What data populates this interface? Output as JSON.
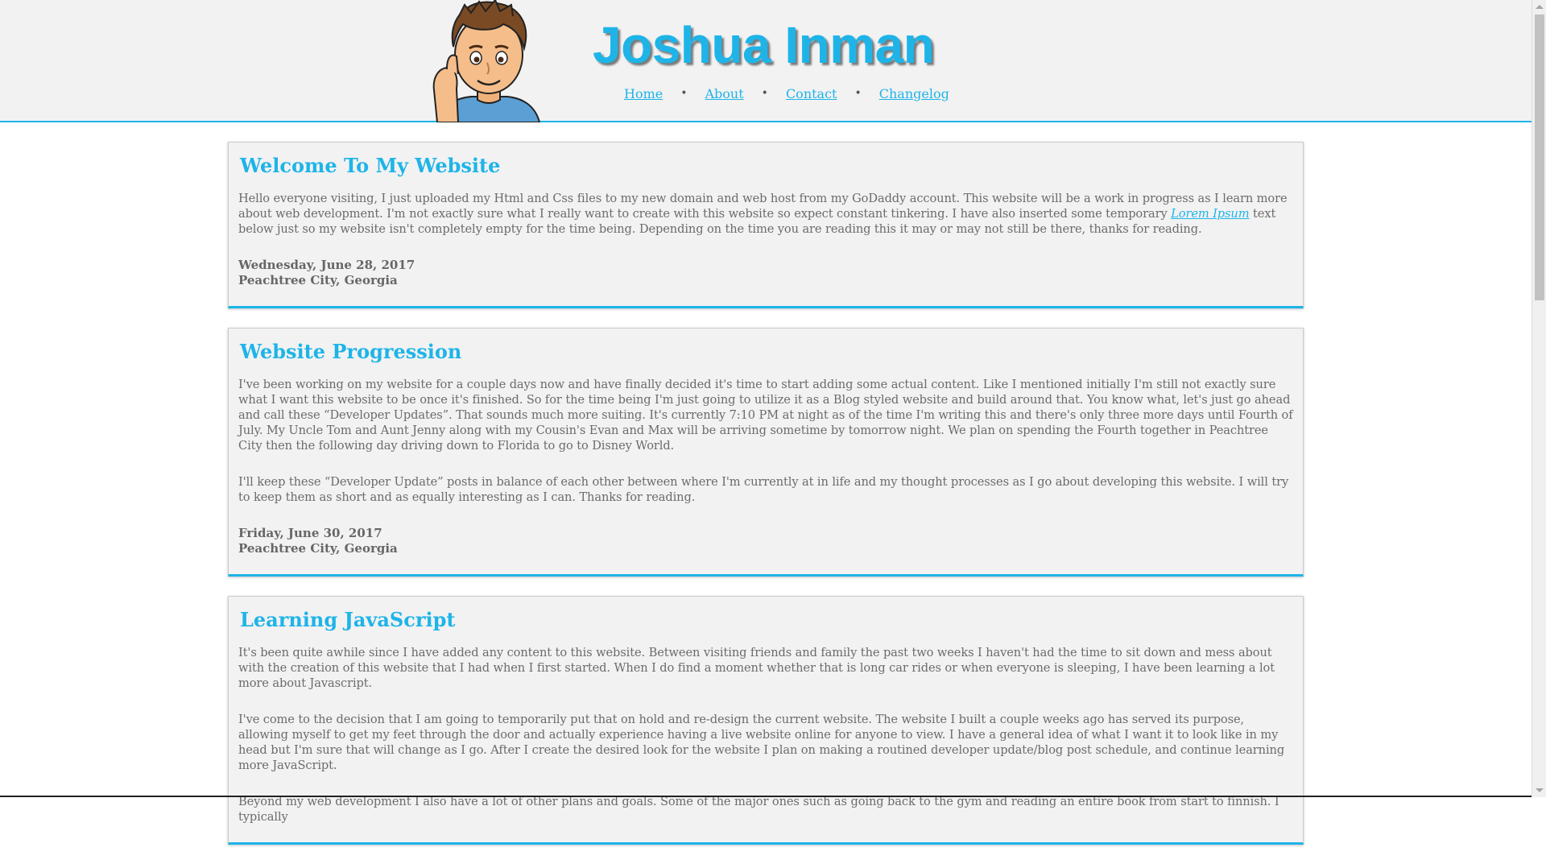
{
  "header": {
    "site_title": "Joshua Inman",
    "nav": [
      {
        "label": "Home"
      },
      {
        "label": "About"
      },
      {
        "label": "Contact"
      },
      {
        "label": "Changelog"
      }
    ],
    "separator": "•"
  },
  "posts": [
    {
      "title": "Welcome To My Website",
      "p1_before": "Hello everyone visiting, I just uploaded my Html and Css files to my new domain and web host from my GoDaddy account. This website will be a work in progress as I learn more about web development. I'm not exactly sure what I really want to create with this website so expect constant tinkering. I have also inserted some temporary ",
      "p1_link": "Lorem Ipsum",
      "p1_after": " text below just so my website isn't completely empty for the time being. Depending on the time you are reading this it may or may not still be there, thanks for reading.",
      "date": "Wednesday, June 28, 2017",
      "location": "Peachtree City, Georgia"
    },
    {
      "title": "Website Progression",
      "paragraphs": [
        "I've been working on my website for a couple days now and have finally decided it's time to start adding some actual content. Like I mentioned initially I'm still not exactly sure what I want this website to be once it's finished. So for the time being I'm just going to utilize it as a Blog styled website and build around that. You know what, let's just go ahead and call these “Developer Updates”. That sounds much more suiting. It's currently 7:10 PM at night as of the time I'm writing this and there's only three more days until Fourth of July. My Uncle Tom and Aunt Jenny along with my Cousin's Evan and Max will be arriving sometime by tomorrow night. We plan on spending the Fourth together in Peachtree City then the following day driving down to Florida to go to Disney World.",
        "I'll keep these “Developer Update” posts in balance of each other between where I'm currently at in life and my thought processes as I go about developing this website. I will try to keep them as short and as equally interesting as I can. Thanks for reading."
      ],
      "date": "Friday, June 30, 2017",
      "location": "Peachtree City, Georgia"
    },
    {
      "title": "Learning JavaScript",
      "paragraphs": [
        "It's been quite awhile since I have added any content to this website. Between visiting friends and family the past two weeks I haven't had the time to sit down and mess about with the creation of this website that I had when I first started. When I do find a moment whether that is long car rides or when everyone is sleeping, I have been learning a lot more about Javascript.",
        "I've come to the decision that I am going to temporarily put that on hold and re-design the current website. The website I built a couple weeks ago has served its purpose, allowing myself to get my feet through the door and actually experience having a live website online for anyone to view. I have a general idea of what I want it to look like in my head but I'm sure that will change as I go. After I create the desired look for the website I plan on making a routined developer update/blog post schedule, and continue learning more JavaScript.",
        "Beyond my web development I also have a lot of other plans and goals. Some of the major ones such as going back to the gym and reading an entire book from start to finnish. I typically"
      ]
    }
  ],
  "colors": {
    "accent": "#1eb4e8",
    "header_bg": "#f2f2f2",
    "card_bg": "#f2f2f2",
    "text": "#666666"
  }
}
